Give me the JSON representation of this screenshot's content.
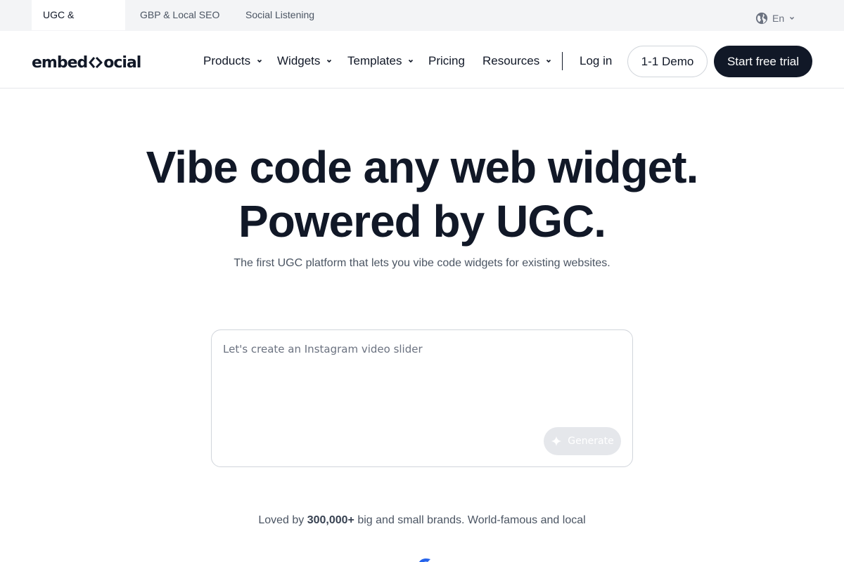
{
  "topbar": {
    "tabs": [
      {
        "label": "UGC & Reviews",
        "active": true
      },
      {
        "label": "GBP & Local SEO",
        "active": false
      },
      {
        "label": "Social Listening",
        "active": false
      }
    ],
    "language": {
      "label": "En",
      "icon": "globe-icon"
    }
  },
  "header": {
    "logo": {
      "left": "embed",
      "right": "ocial"
    },
    "nav": [
      {
        "label": "Products",
        "has_dropdown": true
      },
      {
        "label": "Widgets",
        "has_dropdown": true
      },
      {
        "label": "Templates",
        "has_dropdown": true
      },
      {
        "label": "Pricing",
        "has_dropdown": false
      },
      {
        "label": "Resources",
        "has_dropdown": true
      }
    ],
    "login_label": "Log in",
    "demo_label": "1-1 Demo",
    "trial_label": "Start free trial"
  },
  "hero": {
    "title_line1": "Vibe code any web widget.",
    "title_line2": "Powered by UGC.",
    "subtitle": "The first UGC platform that lets you vibe code widgets for existing websites."
  },
  "prompt": {
    "placeholder": "Let's create an Instagram video slider",
    "generate_label": "Generate"
  },
  "loved": {
    "prefix": "Loved by ",
    "count": "300,000+",
    "suffix": " big and small brands. World-famous and local"
  },
  "colors": {
    "primary_dark": "#111827",
    "topbar_bg": "#f3f4f6",
    "muted_text": "#4b5563",
    "generate_disabled_bg": "#e5e7eb",
    "brand_blue": "#2563eb"
  }
}
